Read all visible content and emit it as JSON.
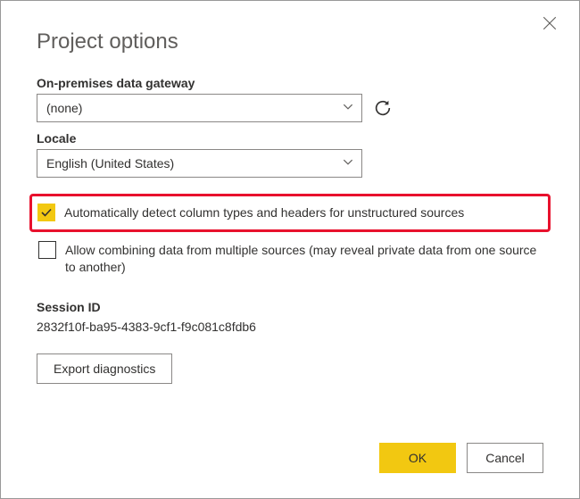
{
  "title": "Project options",
  "gateway": {
    "label": "On-premises data gateway",
    "value": "(none)"
  },
  "locale": {
    "label": "Locale",
    "value": "English (United States)"
  },
  "opt_detect": {
    "label": "Automatically detect column types and headers for unstructured sources",
    "checked": true
  },
  "opt_combine": {
    "label": "Allow combining data from multiple sources (may reveal private data from one source to another)",
    "checked": false
  },
  "session": {
    "label": "Session ID",
    "value": "2832f10f-ba95-4383-9cf1-f9c081c8fdb6"
  },
  "buttons": {
    "export": "Export diagnostics",
    "ok": "OK",
    "cancel": "Cancel"
  }
}
